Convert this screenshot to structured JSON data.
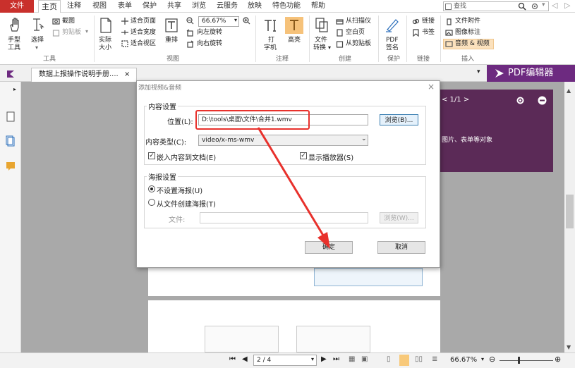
{
  "menubar": {
    "file": "文件",
    "tabs": [
      "主页",
      "注释",
      "视图",
      "表单",
      "保护",
      "共享",
      "浏览",
      "云服务",
      "放映",
      "特色功能",
      "帮助"
    ],
    "search_placeholder": "查找"
  },
  "ribbon": {
    "hand_tool": "手型\n工具",
    "hand_tool_l1": "手型",
    "hand_tool_l2": "工具",
    "select": "选择",
    "screenshot": "截图",
    "paste": "剪贴板",
    "tools_group": "工具",
    "actual_size_l1": "实际",
    "actual_size_l2": "大小",
    "fit_page": "适合页面",
    "fit_width": "适合宽度",
    "fit_view": "适合视区",
    "reflow": "重排",
    "zoom": "66.67%",
    "rotate_left": "向左旋转",
    "rotate_right": "向右旋转",
    "view_group": "视图",
    "typewriter_l1": "打",
    "typewriter_l2": "字机",
    "highlight": "高亮",
    "annotate_group": "注释",
    "file_convert_l1": "文件",
    "file_convert_l2": "转换",
    "from_scanner": "从扫描仪",
    "blank_page": "空白页",
    "from_clipboard": "从剪贴板",
    "create_group": "创建",
    "pdf_sign_l1": "PDF",
    "pdf_sign_l2": "签名",
    "protect_group": "保护",
    "link": "链接",
    "bookmark": "书签",
    "link_group": "链接",
    "file_attach": "文件附件",
    "image_annot": "图像标注",
    "audio_video": "音频 & 视频",
    "insert_group": "插入"
  },
  "tabstrip": {
    "doc_tab": "数据上报操作说明手册....",
    "pdf_editor": "PDF编辑器"
  },
  "purple_panel": {
    "pager": "< 1/1 >",
    "desc": "图片、表单等对象"
  },
  "dialog": {
    "title": "添加视频&音频",
    "content_section": "内容设置",
    "location_label": "位置(L):",
    "location_value": "D:\\tools\\桌面\\文件\\合并1.wmv",
    "browse": "浏览(B)...",
    "content_type_label": "内容类型(C):",
    "content_type_value": "video/x-ms-wmv",
    "embed": "嵌入内容到文档(E)",
    "show_player": "显示播放器(S)",
    "poster_section": "海报设置",
    "no_poster": "不设置海报(U)",
    "from_file": "从文件创建海报(T)",
    "file_label": "文件:",
    "browse_w": "浏览(W)...",
    "ok": "确定",
    "cancel": "取消"
  },
  "statusbar": {
    "page": "2 / 4",
    "zoom": "66.67%"
  },
  "colors": {
    "accent_red": "#c9302c",
    "purple": "#6d2a80",
    "annot_red": "#e8312c"
  }
}
